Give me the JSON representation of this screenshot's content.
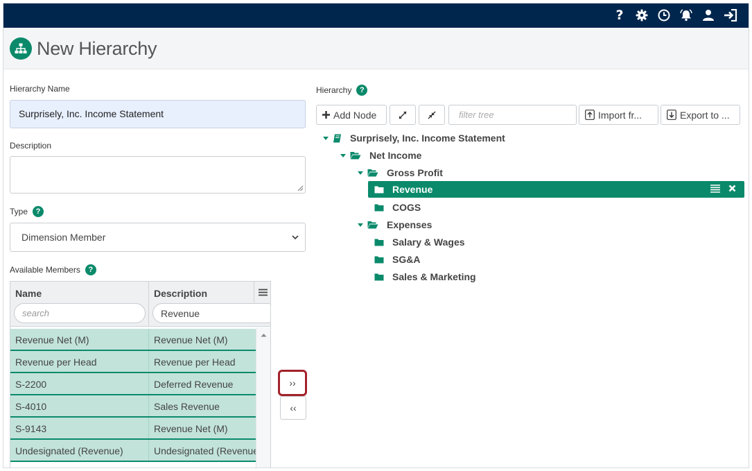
{
  "header": {
    "icons": [
      "help-icon",
      "gear-icon",
      "history-icon",
      "alarm-icon",
      "user-icon",
      "logout-icon"
    ],
    "help_glyph": "?"
  },
  "page": {
    "title": "New Hierarchy",
    "title_icon": "hierarchy-icon"
  },
  "form": {
    "name_label": "Hierarchy Name",
    "name_value": "Surprisely, Inc. Income Statement",
    "description_label": "Description",
    "description_value": "",
    "type_label": "Type",
    "type_value": "Dimension Member",
    "help_glyph": "?"
  },
  "members": {
    "label": "Available Members",
    "columns": [
      "Name",
      "Description"
    ],
    "name_filter_placeholder": "search",
    "description_filter_value": "Revenue",
    "rows": [
      {
        "name": "Revenue Net (M)",
        "description": "Revenue Net (M)"
      },
      {
        "name": "Revenue per Head",
        "description": "Revenue per Head"
      },
      {
        "name": "S-2200",
        "description": "Deferred Revenue"
      },
      {
        "name": "S-4010",
        "description": "Sales Revenue"
      },
      {
        "name": "S-9143",
        "description": "Revenue Net (M)"
      },
      {
        "name": "Undesignated (Revenue)",
        "description": "Undesignated (Revenue)"
      }
    ],
    "add_button": "››",
    "remove_button": "‹‹"
  },
  "hierarchy": {
    "label": "Hierarchy",
    "toolbar": {
      "add_node": "Add Node",
      "filter_placeholder": "filter tree",
      "import": "Import fr...",
      "export": "Export to ..."
    },
    "tree": [
      {
        "label": "Surprisely, Inc. Income Statement",
        "level": 0,
        "icon": "book-icon",
        "expanded": true
      },
      {
        "label": "Net Income",
        "level": 1,
        "icon": "folder-open-icon",
        "expanded": true
      },
      {
        "label": "Gross Profit",
        "level": 2,
        "icon": "folder-open-icon",
        "expanded": true
      },
      {
        "label": "Revenue",
        "level": 3,
        "icon": "folder-icon",
        "selected": true
      },
      {
        "label": "COGS",
        "level": 3,
        "icon": "folder-icon"
      },
      {
        "label": "Expenses",
        "level": 2,
        "icon": "folder-open-icon",
        "expanded": true
      },
      {
        "label": "Salary & Wages",
        "level": 3,
        "icon": "folder-icon"
      },
      {
        "label": "SG&A",
        "level": 3,
        "icon": "folder-icon"
      },
      {
        "label": "Sales & Marketing",
        "level": 3,
        "icon": "folder-icon"
      }
    ]
  },
  "colors": {
    "topbar": "#00264d",
    "accent": "#0a8a6b",
    "row_bg": "#c2e3da",
    "active_border": "#a3222b"
  }
}
